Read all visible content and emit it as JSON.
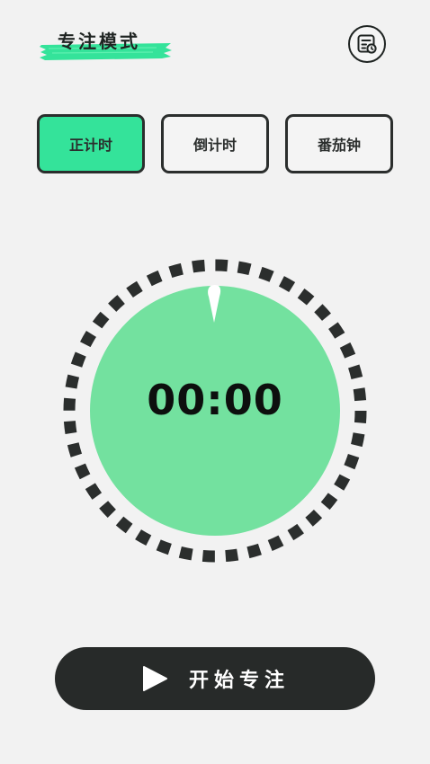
{
  "header": {
    "title": "专注模式",
    "accent_color": "#34e39a",
    "record_icon": "list-clock-icon"
  },
  "modes": {
    "tabs": [
      {
        "label": "正计时",
        "active": true
      },
      {
        "label": "倒计时",
        "active": false
      },
      {
        "label": "番茄钟",
        "active": false
      }
    ],
    "active_color": "#34e39a"
  },
  "timer": {
    "display": "00:00",
    "dial_color": "#73e19f"
  },
  "start_button": {
    "label": "开始专注",
    "icon": "play-icon"
  }
}
